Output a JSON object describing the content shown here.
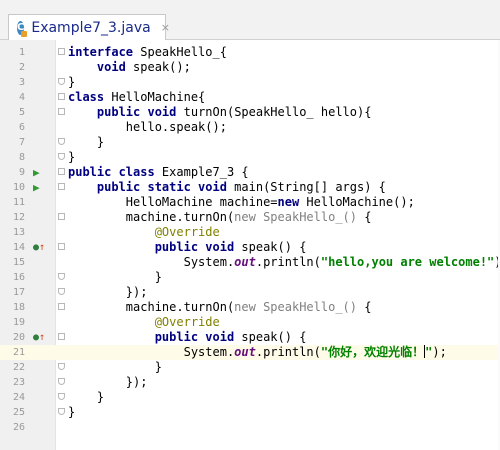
{
  "tab": {
    "label": "Example7_3.java",
    "icon": "C",
    "close": "×"
  },
  "lines": [
    {
      "num": "1",
      "marker": "",
      "fold": "start",
      "tokens": [
        [
          "kw",
          "interface"
        ],
        [
          "plain",
          " SpeakHello_{"
        ]
      ]
    },
    {
      "num": "2",
      "marker": "",
      "fold": "",
      "tokens": [
        [
          "plain",
          "    "
        ],
        [
          "kw",
          "void"
        ],
        [
          "plain",
          " speak();"
        ]
      ]
    },
    {
      "num": "3",
      "marker": "",
      "fold": "end",
      "tokens": [
        [
          "plain",
          "}"
        ]
      ]
    },
    {
      "num": "4",
      "marker": "",
      "fold": "start",
      "tokens": [
        [
          "kw",
          "class"
        ],
        [
          "plain",
          " HelloMachine{"
        ]
      ]
    },
    {
      "num": "5",
      "marker": "",
      "fold": "start",
      "tokens": [
        [
          "plain",
          "    "
        ],
        [
          "kw",
          "public void"
        ],
        [
          "plain",
          " turnOn(SpeakHello_ hello){"
        ]
      ]
    },
    {
      "num": "6",
      "marker": "",
      "fold": "",
      "tokens": [
        [
          "plain",
          "        hello.speak();"
        ]
      ]
    },
    {
      "num": "7",
      "marker": "",
      "fold": "end",
      "tokens": [
        [
          "plain",
          "    }"
        ]
      ]
    },
    {
      "num": "8",
      "marker": "",
      "fold": "end",
      "tokens": [
        [
          "plain",
          "}"
        ]
      ]
    },
    {
      "num": "9",
      "marker": "run",
      "fold": "start",
      "tokens": [
        [
          "kw",
          "public class"
        ],
        [
          "plain",
          " Example7_3 {"
        ]
      ]
    },
    {
      "num": "10",
      "marker": "run",
      "fold": "start",
      "tokens": [
        [
          "plain",
          "    "
        ],
        [
          "kw",
          "public static void"
        ],
        [
          "plain",
          " main(String[] args) {"
        ]
      ]
    },
    {
      "num": "11",
      "marker": "",
      "fold": "",
      "tokens": [
        [
          "plain",
          "        HelloMachine machine="
        ],
        [
          "kw",
          "new"
        ],
        [
          "plain",
          " HelloMachine();"
        ]
      ]
    },
    {
      "num": "12",
      "marker": "",
      "fold": "start",
      "tokens": [
        [
          "plain",
          "        machine.turnOn("
        ],
        [
          "gray",
          "new SpeakHello_()"
        ],
        [
          "plain",
          " {"
        ]
      ]
    },
    {
      "num": "13",
      "marker": "",
      "fold": "",
      "tokens": [
        [
          "plain",
          "            "
        ],
        [
          "ann",
          "@Override"
        ]
      ]
    },
    {
      "num": "14",
      "marker": "override",
      "fold": "start",
      "tokens": [
        [
          "plain",
          "            "
        ],
        [
          "kw",
          "public void"
        ],
        [
          "plain",
          " speak() {"
        ]
      ]
    },
    {
      "num": "15",
      "marker": "",
      "fold": "",
      "tokens": [
        [
          "plain",
          "                System."
        ],
        [
          "fld",
          "out"
        ],
        [
          "plain",
          ".println("
        ],
        [
          "str",
          "\"hello,you are welcome!\""
        ],
        [
          "plain",
          ");"
        ]
      ]
    },
    {
      "num": "16",
      "marker": "",
      "fold": "end",
      "tokens": [
        [
          "plain",
          "            }"
        ]
      ]
    },
    {
      "num": "17",
      "marker": "",
      "fold": "end",
      "tokens": [
        [
          "plain",
          "        });"
        ]
      ]
    },
    {
      "num": "18",
      "marker": "",
      "fold": "start",
      "tokens": [
        [
          "plain",
          "        machine.turnOn("
        ],
        [
          "gray",
          "new SpeakHello_()"
        ],
        [
          "plain",
          " {"
        ]
      ]
    },
    {
      "num": "19",
      "marker": "",
      "fold": "",
      "tokens": [
        [
          "plain",
          "            "
        ],
        [
          "ann",
          "@Override"
        ]
      ]
    },
    {
      "num": "20",
      "marker": "override",
      "fold": "start",
      "tokens": [
        [
          "plain",
          "            "
        ],
        [
          "kw",
          "public void"
        ],
        [
          "plain",
          " speak() {"
        ]
      ]
    },
    {
      "num": "21",
      "marker": "",
      "fold": "",
      "current": true,
      "tokens": [
        [
          "plain",
          "                System."
        ],
        [
          "fld",
          "out"
        ],
        [
          "plain",
          ".println("
        ],
        [
          "str",
          "\"你好，欢迎光临！"
        ],
        [
          "caret",
          ""
        ],
        [
          "str",
          "\""
        ],
        [
          "plain",
          ");"
        ]
      ]
    },
    {
      "num": "22",
      "marker": "",
      "fold": "end",
      "tokens": [
        [
          "plain",
          "            }"
        ]
      ]
    },
    {
      "num": "23",
      "marker": "",
      "fold": "end",
      "tokens": [
        [
          "plain",
          "        });"
        ]
      ]
    },
    {
      "num": "24",
      "marker": "",
      "fold": "end",
      "tokens": [
        [
          "plain",
          "    }"
        ]
      ]
    },
    {
      "num": "25",
      "marker": "",
      "fold": "end",
      "tokens": [
        [
          "plain",
          "}"
        ]
      ]
    },
    {
      "num": "26",
      "marker": "",
      "fold": "",
      "tokens": []
    }
  ],
  "icons": {
    "run": "run-gutter-icon",
    "override": "override-gutter-icon"
  }
}
